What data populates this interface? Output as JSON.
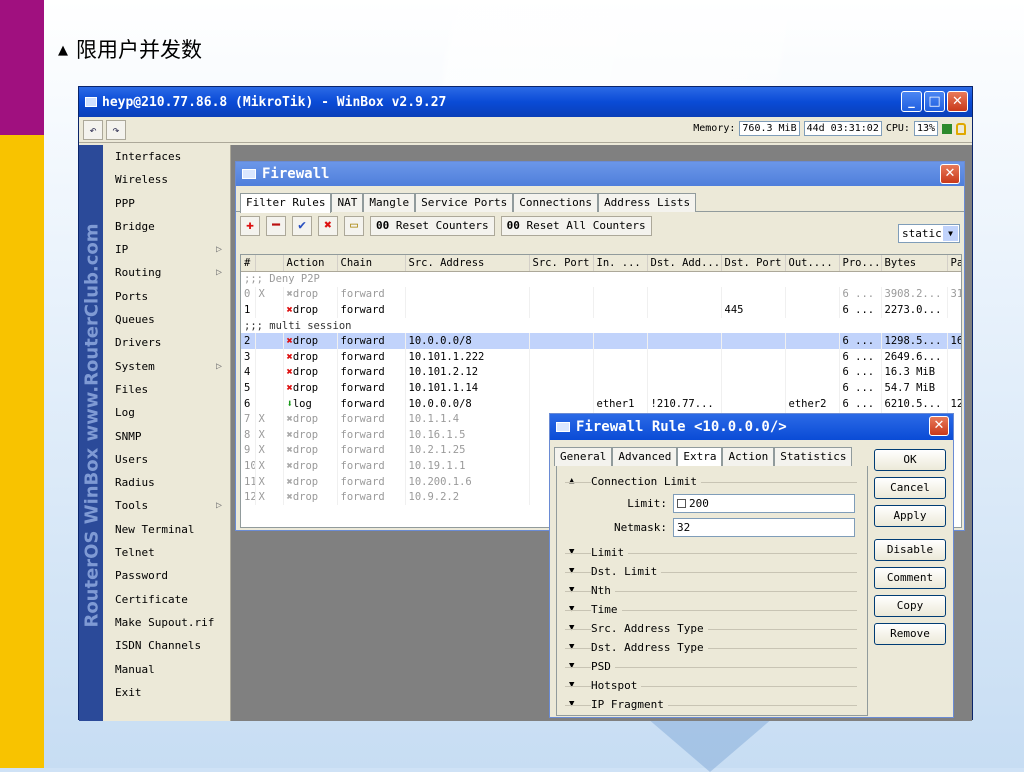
{
  "slide": {
    "title": "限用户并发数",
    "bullet": "▲"
  },
  "watermark": "RouterOS WinBox  www.RouterClub.com",
  "window": {
    "title": "heyp@210.77.86.8 (MikroTik) - WinBox v2.9.27",
    "buttons": {
      "minimize": "_",
      "maximize": "□",
      "close": "✕"
    }
  },
  "toolbar": {
    "undo_icon": "↶",
    "redo_icon": "↷",
    "memory_label": "Memory:",
    "memory_value": "760.3 MiB",
    "uptime": "44d 03:31:02",
    "cpu_label": "CPU:",
    "cpu_value": "13%"
  },
  "sidebar": {
    "items": [
      {
        "label": "Interfaces",
        "arrow": ""
      },
      {
        "label": "Wireless",
        "arrow": ""
      },
      {
        "label": "PPP",
        "arrow": ""
      },
      {
        "label": "Bridge",
        "arrow": ""
      },
      {
        "label": "IP",
        "arrow": "▷"
      },
      {
        "label": "Routing",
        "arrow": "▷"
      },
      {
        "label": "Ports",
        "arrow": ""
      },
      {
        "label": "Queues",
        "arrow": ""
      },
      {
        "label": "Drivers",
        "arrow": ""
      },
      {
        "label": "System",
        "arrow": "▷"
      },
      {
        "label": "Files",
        "arrow": ""
      },
      {
        "label": "Log",
        "arrow": ""
      },
      {
        "label": "SNMP",
        "arrow": ""
      },
      {
        "label": "Users",
        "arrow": ""
      },
      {
        "label": "Radius",
        "arrow": ""
      },
      {
        "label": "Tools",
        "arrow": "▷"
      },
      {
        "label": "New Terminal",
        "arrow": ""
      },
      {
        "label": "Telnet",
        "arrow": ""
      },
      {
        "label": "Password",
        "arrow": ""
      },
      {
        "label": "Certificate",
        "arrow": ""
      },
      {
        "label": "Make Supout.rif",
        "arrow": ""
      },
      {
        "label": "ISDN Channels",
        "arrow": ""
      },
      {
        "label": "Manual",
        "arrow": ""
      },
      {
        "label": "Exit",
        "arrow": ""
      }
    ]
  },
  "firewall": {
    "title": "Firewall",
    "tabs": [
      "Filter Rules",
      "NAT",
      "Mangle",
      "Service Ports",
      "Connections",
      "Address Lists"
    ],
    "icons": {
      "add": "✚",
      "remove": "━",
      "enable": "✔",
      "disable": "✖",
      "comment": "▭"
    },
    "reset_counters": "Reset Counters",
    "reset_all_counters": "Reset All Counters",
    "reset_prefix": "00",
    "static_select": "static",
    "columns": [
      "#",
      "",
      "Action",
      "Chain",
      "Src. Address",
      "Src. Port",
      "In. ...",
      "Dst. Add...",
      "Dst. Port",
      "Out....",
      "Pro...",
      "Bytes",
      "Pa"
    ],
    "rows": [
      {
        "type": "comment",
        "disabled": true,
        "text": ";;; Deny P2P"
      },
      {
        "type": "rule",
        "disabled": true,
        "num": "0",
        "flag": "X",
        "action": "drop",
        "chain": "forward",
        "src": "",
        "srcport": "",
        "in": "",
        "dst": "",
        "dstport": "",
        "out": "",
        "proto": "6 ...",
        "bytes": "3908.2...",
        "pa": "31"
      },
      {
        "type": "rule",
        "disabled": false,
        "num": "1",
        "flag": "",
        "action": "drop",
        "chain": "forward",
        "src": "",
        "srcport": "",
        "in": "",
        "dst": "",
        "dstport": "445",
        "out": "",
        "proto": "6 ...",
        "bytes": "2273.0...",
        "pa": ""
      },
      {
        "type": "comment",
        "disabled": false,
        "text": ";;; multi session"
      },
      {
        "type": "rule",
        "selected": true,
        "disabled": false,
        "num": "2",
        "flag": "",
        "action": "drop",
        "chain": "forward",
        "src": "10.0.0.0/8",
        "srcport": "",
        "in": "",
        "dst": "",
        "dstport": "",
        "out": "",
        "proto": "6 ...",
        "bytes": "1298.5...",
        "pa": "16"
      },
      {
        "type": "rule",
        "disabled": false,
        "num": "3",
        "flag": "",
        "action": "drop",
        "chain": "forward",
        "src": "10.101.1.222",
        "srcport": "",
        "in": "",
        "dst": "",
        "dstport": "",
        "out": "",
        "proto": "6 ...",
        "bytes": "2649.6...",
        "pa": ""
      },
      {
        "type": "rule",
        "disabled": false,
        "num": "4",
        "flag": "",
        "action": "drop",
        "chain": "forward",
        "src": "10.101.2.12",
        "srcport": "",
        "in": "",
        "dst": "",
        "dstport": "",
        "out": "",
        "proto": "6 ...",
        "bytes": "16.3 MiB",
        "pa": ""
      },
      {
        "type": "rule",
        "disabled": false,
        "num": "5",
        "flag": "",
        "action": "drop",
        "chain": "forward",
        "src": "10.101.1.14",
        "srcport": "",
        "in": "",
        "dst": "",
        "dstport": "",
        "out": "",
        "proto": "6 ...",
        "bytes": "54.7 MiB",
        "pa": ""
      },
      {
        "type": "rule",
        "disabled": false,
        "num": "6",
        "flag": "",
        "action": "log",
        "chain": "forward",
        "src": "10.0.0.0/8",
        "srcport": "",
        "in": "ether1",
        "dst": "!210.77...",
        "dstport": "",
        "out": "ether2",
        "proto": "6 ...",
        "bytes": "6210.5...",
        "pa": "12"
      },
      {
        "type": "rule",
        "disabled": true,
        "num": "7",
        "flag": "X",
        "action": "drop",
        "chain": "forward",
        "src": "10.1.1.4",
        "srcport": "",
        "in": "",
        "dst": "",
        "dstport": "",
        "out": "",
        "proto": "",
        "bytes": "",
        "pa": ""
      },
      {
        "type": "rule",
        "disabled": true,
        "num": "8",
        "flag": "X",
        "action": "drop",
        "chain": "forward",
        "src": "10.16.1.5",
        "srcport": "",
        "in": "",
        "dst": "",
        "dstport": "",
        "out": "",
        "proto": "",
        "bytes": "",
        "pa": ""
      },
      {
        "type": "rule",
        "disabled": true,
        "num": "9",
        "flag": "X",
        "action": "drop",
        "chain": "forward",
        "src": "10.2.1.25",
        "srcport": "",
        "in": "",
        "dst": "",
        "dstport": "",
        "out": "",
        "proto": "",
        "bytes": "",
        "pa": ""
      },
      {
        "type": "rule",
        "disabled": true,
        "num": "10",
        "flag": "X",
        "action": "drop",
        "chain": "forward",
        "src": "10.19.1.1",
        "srcport": "",
        "in": "",
        "dst": "",
        "dstport": "",
        "out": "",
        "proto": "",
        "bytes": "",
        "pa": ""
      },
      {
        "type": "rule",
        "disabled": true,
        "num": "11",
        "flag": "X",
        "action": "drop",
        "chain": "forward",
        "src": "10.200.1.6",
        "srcport": "",
        "in": "",
        "dst": "",
        "dstport": "",
        "out": "",
        "proto": "",
        "bytes": "",
        "pa": ""
      },
      {
        "type": "rule",
        "disabled": true,
        "num": "12",
        "flag": "X",
        "action": "drop",
        "chain": "forward",
        "src": "10.9.2.2",
        "srcport": "",
        "in": "",
        "dst": "",
        "dstport": "",
        "out": "",
        "proto": "",
        "bytes": "",
        "pa": ""
      }
    ]
  },
  "rule_dialog": {
    "title": "Firewall Rule <10.0.0.0/>",
    "tabs": [
      "General",
      "Advanced",
      "Extra",
      "Action",
      "Statistics"
    ],
    "active_tab": "Extra",
    "connection_limit": {
      "label": "Connection Limit",
      "limit_label": "Limit:",
      "limit_value": "200",
      "netmask_label": "Netmask:",
      "netmask_value": "32"
    },
    "sections": [
      "Limit",
      "Dst. Limit",
      "Nth",
      "Time",
      "Src. Address Type",
      "Dst. Address Type",
      "PSD",
      "Hotspot",
      "IP Fragment"
    ],
    "buttons": [
      "OK",
      "Cancel",
      "Apply",
      "Disable",
      "Comment",
      "Copy",
      "Remove"
    ]
  }
}
